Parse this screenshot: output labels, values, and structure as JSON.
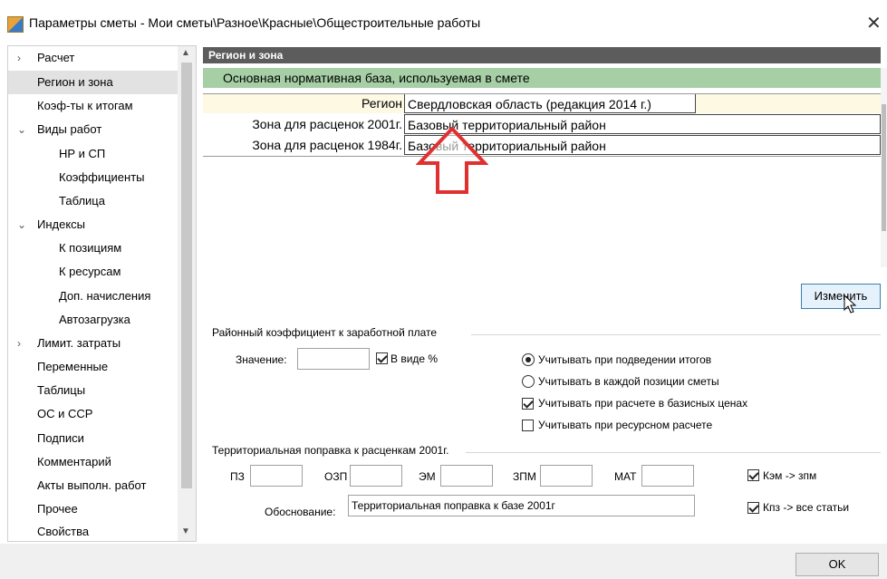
{
  "window": {
    "title": "Параметры сметы - Мои сметы\\Разное\\Красные\\Общестроительные работы",
    "close_glyph": "✕"
  },
  "sidebar": {
    "items": [
      {
        "label": "Расчет",
        "arrow": "›"
      },
      {
        "label": "Регион и зона"
      },
      {
        "label": "Коэф-ты к итогам"
      },
      {
        "label": "Виды работ",
        "arrow": "⌄"
      },
      {
        "label": "НР и СП"
      },
      {
        "label": "Коэффициенты"
      },
      {
        "label": "Таблица"
      },
      {
        "label": "Индексы",
        "arrow": "⌄"
      },
      {
        "label": "К позициям"
      },
      {
        "label": "К ресурсам"
      },
      {
        "label": "Доп. начисления"
      },
      {
        "label": "Автозагрузка"
      },
      {
        "label": "Лимит. затраты",
        "arrow": "›"
      },
      {
        "label": "Переменные"
      },
      {
        "label": "Таблицы"
      },
      {
        "label": "ОС и ССР"
      },
      {
        "label": "Подписи"
      },
      {
        "label": "Комментарий"
      },
      {
        "label": "Акты выполн. работ"
      },
      {
        "label": "Прочее"
      },
      {
        "label": "Свойства"
      }
    ],
    "selected_index": 1
  },
  "main": {
    "section_title": "Регион и зона",
    "base_row": "Основная нормативная база, используемая в смете",
    "rows": [
      {
        "label": "Регион",
        "value": "Свердловская область (редакция 2014 г.)"
      },
      {
        "label": "Зона для расценок 2001г.",
        "value": "Базовый территориальный район"
      },
      {
        "label": "Зона для расценок 1984г.",
        "value": "Базовый территориальный район"
      }
    ],
    "change_button": "Изменить",
    "district": {
      "title": "Районный коэффициент к заработной плате",
      "value_label": "Значение:",
      "value": "",
      "percent_label": "В виде %",
      "percent_checked": true,
      "radio_totals": "Учитывать при подведении итогов",
      "radio_totals_checked": true,
      "radio_each": "Учитывать в каждой позиции сметы",
      "radio_each_checked": false,
      "check_base_prices": "Учитывать при расчете в базисных ценах",
      "check_base_prices_checked": true,
      "check_resource": "Учитывать при ресурсном расчете",
      "check_resource_checked": false
    },
    "territorial": {
      "title": "Территориальная поправка к расценкам 2001г.",
      "fields": [
        {
          "label": "ПЗ",
          "value": ""
        },
        {
          "label": "ОЗП",
          "value": ""
        },
        {
          "label": "ЭМ",
          "value": ""
        },
        {
          "label": "ЗПМ",
          "value": ""
        },
        {
          "label": "МАТ",
          "value": ""
        }
      ],
      "kem_label": "Кэм -> зпм",
      "kem_checked": true,
      "basis_label": "Обоснование:",
      "basis_value": "Территориальная поправка к базе 2001г",
      "kpz_label": "Кпз -> все статьи",
      "kpz_checked": true
    }
  },
  "footer": {
    "ok_button": "OK"
  },
  "colors": {
    "header_bg": "#5c5c5c",
    "base_row_bg": "#a6cfa6",
    "selected_row_bg": "#fdf9e3",
    "arrow_red": "#e03030"
  }
}
